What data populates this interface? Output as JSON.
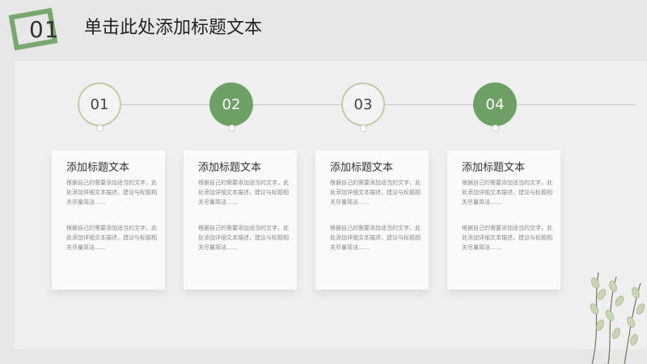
{
  "header": {
    "badge_number": "01",
    "title": "单击此处添加标题文本"
  },
  "steps": [
    {
      "number": "01",
      "style": "outline",
      "title": "添加标题文本",
      "paragraph_1": "根据自己的需要添加适当的文字，此处添加详细文本描述，建议与标题相关尽量简洁……",
      "paragraph_2": "根据自己的需要添加适当的文字，此处添加详细文本描述，建议与标题相关尽量简洁……"
    },
    {
      "number": "02",
      "style": "filled",
      "title": "添加标题文本",
      "paragraph_1": "根据自己的需要添加适当的文字，此处添加详细文本描述，建议与标题相关尽量简洁……",
      "paragraph_2": "根据自己的需要添加适当的文字，此处添加详细文本描述，建议与标题相关尽量简洁……"
    },
    {
      "number": "03",
      "style": "outline",
      "title": "添加标题文本",
      "paragraph_1": "根据自己的需要添加适当的文字，此处添加详细文本描述，建议与标题相关尽量简洁……",
      "paragraph_2": "根据自己的需要添加适当的文字，此处添加详细文本描述，建议与标题相关尽量简洁……"
    },
    {
      "number": "04",
      "style": "filled",
      "title": "添加标题文本",
      "paragraph_1": "根据自己的需要添加适当的文字，此处添加详细文本描述，建议与标题相关尽量简洁……",
      "paragraph_2": "根据自己的需要添加适当的文字，此处添加详细文本描述，建议与标题相关尽量简洁……"
    }
  ],
  "colors": {
    "accent": "#6da064",
    "outline": "#c1cca5",
    "background": "#e6e7e6",
    "panel": "#efefef"
  },
  "icons": {
    "badge": "square-frame-icon",
    "decoration": "plant-branch-icon"
  }
}
